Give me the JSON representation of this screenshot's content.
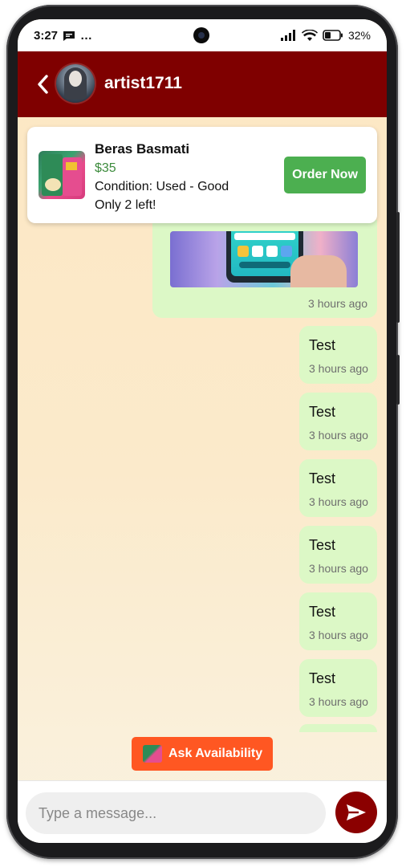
{
  "status_bar": {
    "time": "3:27",
    "more": "…",
    "battery": "32%"
  },
  "header": {
    "username": "artist1711",
    "back_icon": "chevron-left-icon",
    "color": "#7f0000"
  },
  "product": {
    "title": "Beras Basmati",
    "price": "$35",
    "condition": "Condition: Used - Good",
    "stock": "Only 2 left!",
    "order_label": "Order Now",
    "order_color": "#4caf50",
    "price_color": "#3c8b3c"
  },
  "messages": [
    {
      "type": "image",
      "time": "3 hours ago"
    },
    {
      "type": "text",
      "text": "Test",
      "time": "3 hours ago"
    },
    {
      "type": "text",
      "text": "Test",
      "time": "3 hours ago"
    },
    {
      "type": "text",
      "text": "Test",
      "time": "3 hours ago"
    },
    {
      "type": "text",
      "text": "Test",
      "time": "3 hours ago"
    },
    {
      "type": "text",
      "text": "Test",
      "time": "3 hours ago"
    },
    {
      "type": "text",
      "text": "Test",
      "time": "3 hours ago"
    }
  ],
  "ask_button": {
    "label": "Ask Availability",
    "color": "#ff5722"
  },
  "composer": {
    "placeholder": "Type a message...",
    "value": "",
    "send_color": "#8b0000"
  },
  "bubble_color": "#dcf8c6"
}
